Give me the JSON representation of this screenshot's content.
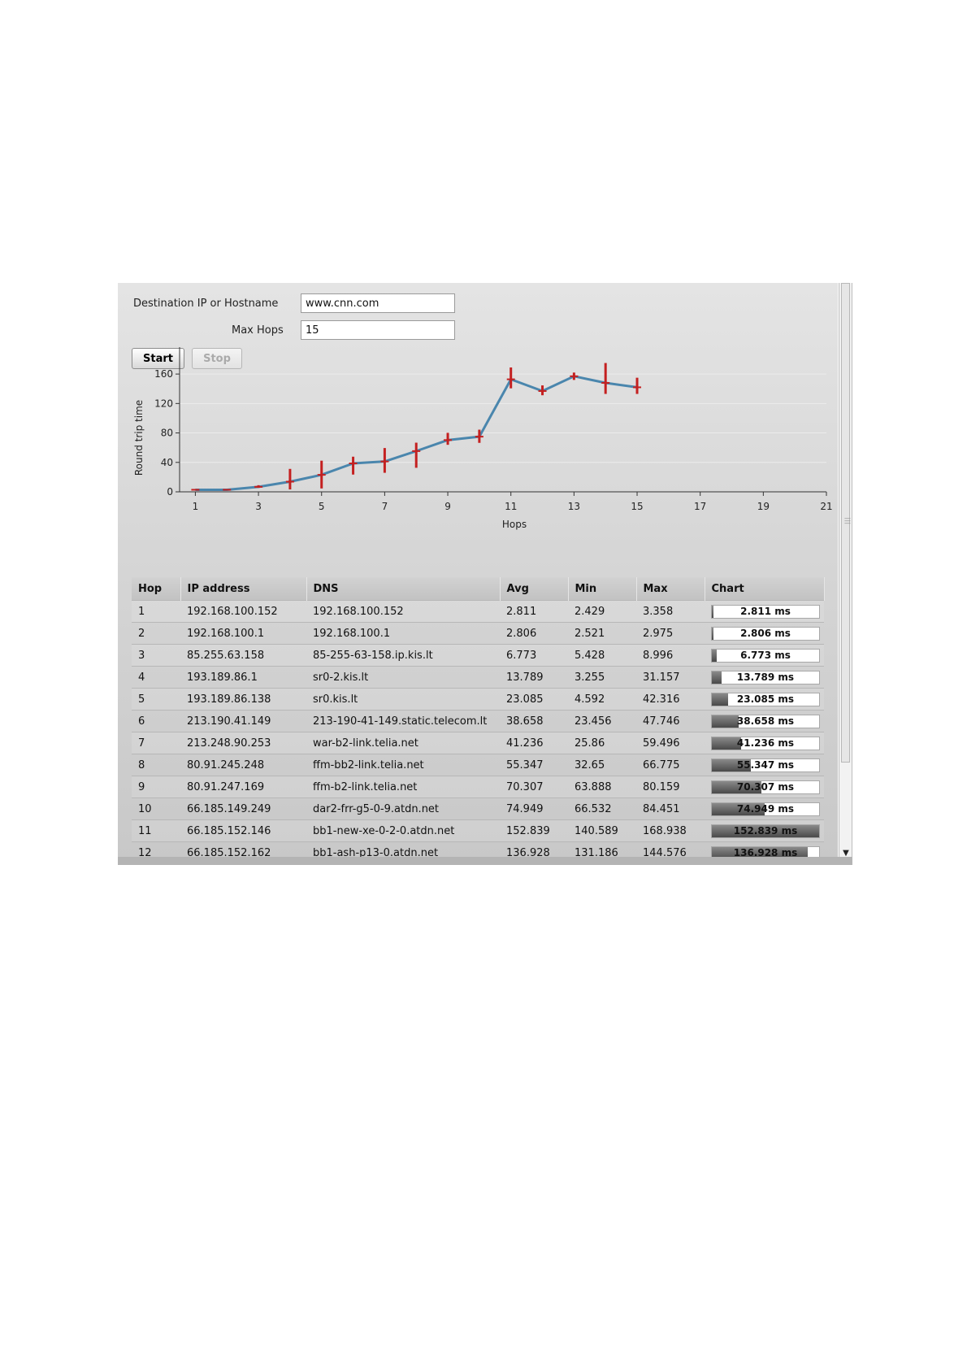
{
  "form": {
    "destination_label": "Destination IP or Hostname",
    "destination_value": "www.cnn.com",
    "max_hops_label": "Max Hops",
    "max_hops_value": "15",
    "start_label": "Start",
    "stop_label": "Stop"
  },
  "chart_data": {
    "type": "line",
    "xlabel": "Hops",
    "ylabel": "Round trip time",
    "xlim": [
      1,
      21
    ],
    "ylim": [
      0,
      180
    ],
    "xticks": [
      1,
      3,
      5,
      7,
      9,
      11,
      13,
      15,
      17,
      19,
      21
    ],
    "yticks": [
      0,
      40,
      80,
      120,
      160
    ],
    "grid": true,
    "x": [
      1,
      2,
      3,
      4,
      5,
      6,
      7,
      8,
      9,
      10,
      11,
      12,
      13,
      14,
      15
    ],
    "avg": [
      2.811,
      2.806,
      6.773,
      13.789,
      23.085,
      38.658,
      41.236,
      55.347,
      70.307,
      74.949,
      152.839,
      136.928,
      157,
      148,
      142
    ],
    "min": [
      2.429,
      2.521,
      5.428,
      3.255,
      4.592,
      23.456,
      25.86,
      32.65,
      63.888,
      66.532,
      140.589,
      131.186,
      152,
      133,
      133
    ],
    "max": [
      3.358,
      2.975,
      8.996,
      31.157,
      42.316,
      47.746,
      59.496,
      66.775,
      80.159,
      84.451,
      168.938,
      144.576,
      162,
      175,
      155
    ],
    "line_color": "#4a86ad",
    "error_color": "#c42020"
  },
  "table": {
    "columns": [
      "Hop",
      "IP address",
      "DNS",
      "Avg",
      "Min",
      "Max",
      "Chart"
    ],
    "rows": [
      {
        "hop": "1",
        "ip": "192.168.100.152",
        "dns": "192.168.100.152",
        "avg": "2.811",
        "min": "2.429",
        "max": "3.358",
        "bar": "2.811 ms",
        "level": 0.018
      },
      {
        "hop": "2",
        "ip": "192.168.100.1",
        "dns": "192.168.100.1",
        "avg": "2.806",
        "min": "2.521",
        "max": "2.975",
        "bar": "2.806 ms",
        "level": 0.018
      },
      {
        "hop": "3",
        "ip": "85.255.63.158",
        "dns": "85-255-63-158.ip.kis.lt",
        "avg": "6.773",
        "min": "5.428",
        "max": "8.996",
        "bar": "6.773 ms",
        "level": 0.044
      },
      {
        "hop": "4",
        "ip": "193.189.86.1",
        "dns": "sr0-2.kis.lt",
        "avg": "13.789",
        "min": "3.255",
        "max": "31.157",
        "bar": "13.789 ms",
        "level": 0.09
      },
      {
        "hop": "5",
        "ip": "193.189.86.138",
        "dns": "sr0.kis.lt",
        "avg": "23.085",
        "min": "4.592",
        "max": "42.316",
        "bar": "23.085 ms",
        "level": 0.151
      },
      {
        "hop": "6",
        "ip": "213.190.41.149",
        "dns": "213-190-41-149.static.telecom.lt",
        "avg": "38.658",
        "min": "23.456",
        "max": "47.746",
        "bar": "38.658 ms",
        "level": 0.253
      },
      {
        "hop": "7",
        "ip": "213.248.90.253",
        "dns": "war-b2-link.telia.net",
        "avg": "41.236",
        "min": "25.86",
        "max": "59.496",
        "bar": "41.236 ms",
        "level": 0.27
      },
      {
        "hop": "8",
        "ip": "80.91.245.248",
        "dns": "ffm-bb2-link.telia.net",
        "avg": "55.347",
        "min": "32.65",
        "max": "66.775",
        "bar": "55.347 ms",
        "level": 0.362
      },
      {
        "hop": "9",
        "ip": "80.91.247.169",
        "dns": "ffm-b2-link.telia.net",
        "avg": "70.307",
        "min": "63.888",
        "max": "80.159",
        "bar": "70.307 ms",
        "level": 0.46
      },
      {
        "hop": "10",
        "ip": "66.185.149.249",
        "dns": "dar2-frr-g5-0-9.atdn.net",
        "avg": "74.949",
        "min": "66.532",
        "max": "84.451",
        "bar": "74.949 ms",
        "level": 0.49
      },
      {
        "hop": "11",
        "ip": "66.185.152.146",
        "dns": "bb1-new-xe-0-2-0.atdn.net",
        "avg": "152.839",
        "min": "140.589",
        "max": "168.938",
        "bar": "152.839 ms",
        "level": 1.0
      },
      {
        "hop": "12",
        "ip": "66.185.152.162",
        "dns": "bb1-ash-p13-0.atdn.net",
        "avg": "136.928",
        "min": "131.186",
        "max": "144.576",
        "bar": "136.928 ms",
        "level": 0.896
      }
    ]
  }
}
